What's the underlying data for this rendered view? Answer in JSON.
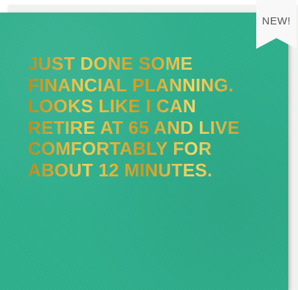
{
  "card": {
    "background_color": "#2fb08d",
    "text_color": "#d9b13a",
    "lines": [
      "JUST DONE SOME",
      "FINANCIAL PLANNING.",
      "LOOKS LIKE I CAN",
      "RETIRE AT 65 AND LIVE",
      "COMFORTABLY FOR",
      "ABOUT 12 MINUTES."
    ]
  },
  "tag": {
    "label": "NEW!",
    "color": "#f8f8f8"
  }
}
